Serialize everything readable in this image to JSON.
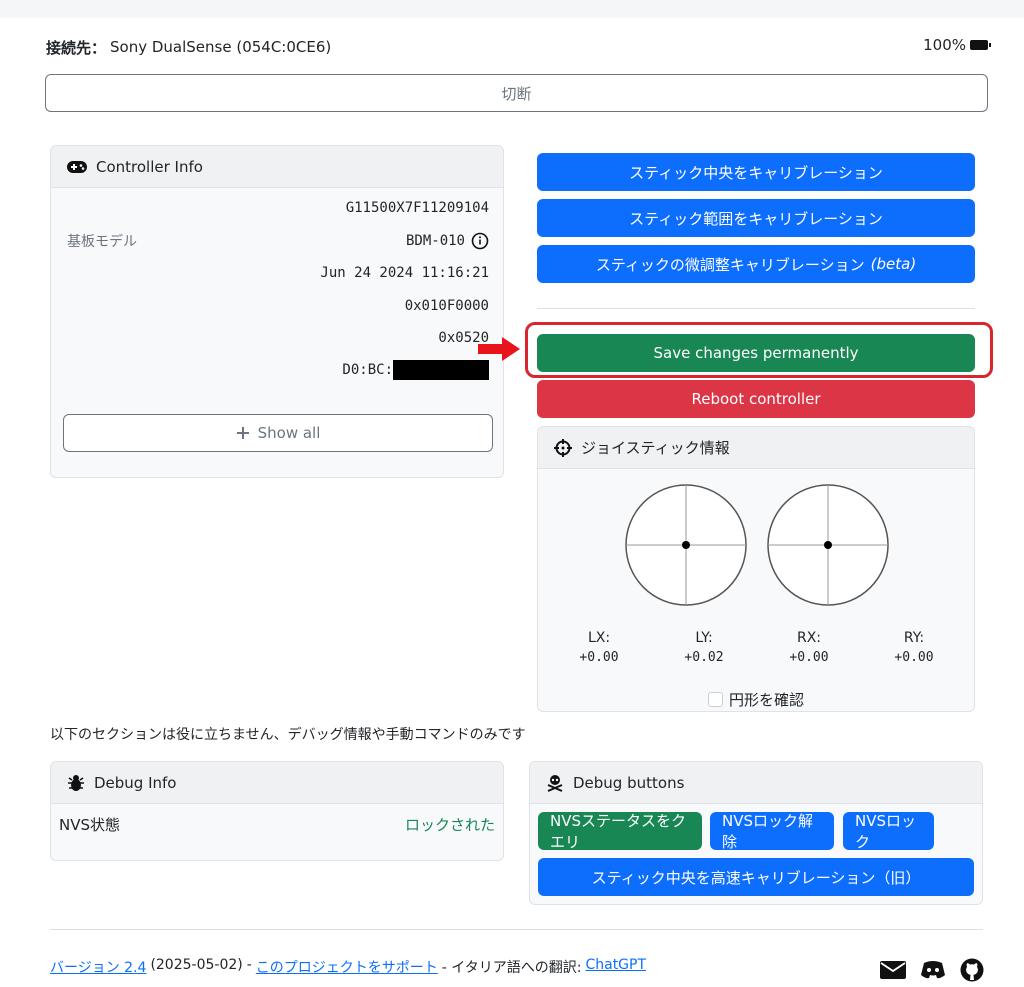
{
  "connection": {
    "label": "接続先：",
    "device": "Sony DualSense (054C:0CE6)",
    "battery": "100%"
  },
  "disconnect_label": "切断",
  "controller_info": {
    "title": "Controller Info",
    "rows": [
      {
        "label": "",
        "value": "G11500X7F11209104"
      },
      {
        "label": "基板モデル",
        "value": "BDM-010"
      },
      {
        "label": "",
        "value": "Jun 24 2024 11:16:21"
      },
      {
        "label": "",
        "value": "0x010F0000"
      },
      {
        "label": "",
        "value": "0x0520"
      },
      {
        "label": "",
        "value": "D0:BC:"
      }
    ],
    "show_all": "Show all"
  },
  "calibration": {
    "center": "スティック中央をキャリブレーション",
    "range": "スティック範囲をキャリブレーション",
    "fine": "スティックの微調整キャリブレーション",
    "fine_beta": "(beta)"
  },
  "save_label": "Save changes permanently",
  "reboot_label": "Reboot controller",
  "joystick": {
    "title": "ジョイスティック情報",
    "axes": [
      {
        "name": "LX:",
        "value": "+0.00"
      },
      {
        "name": "LY:",
        "value": "+0.02"
      },
      {
        "name": "RX:",
        "value": "+0.00"
      },
      {
        "name": "RY:",
        "value": "+0.00"
      }
    ],
    "circle_check_label": "円形を確認"
  },
  "debug_note": "以下のセクションは役に立ちません、デバッグ情報や手動コマンドのみです",
  "debug_info": {
    "title": "Debug Info",
    "nvs_label": "NVS状態",
    "nvs_value": "ロックされた"
  },
  "debug_buttons": {
    "title": "Debug buttons",
    "query": "NVSステータスをクエリ",
    "unlock": "NVSロック解除",
    "lock": "NVSロック",
    "fast_center": "スティック中央を高速キャリブレーション（旧）"
  },
  "footer": {
    "version_link": "バージョン 2.4",
    "date": "(2025-05-02)",
    "sep1": "-",
    "support_link": "このプロジェクトをサポート",
    "translation": "- イタリア語への翻訳:",
    "translator_link": "ChatGPT"
  },
  "colors": {
    "primary": "#0d6efd",
    "success": "#198754",
    "danger": "#dc3545",
    "highlight": "#d9262d"
  },
  "icons": [
    "battery-full-icon",
    "gamepad-icon",
    "info-circle-icon",
    "plus-icon",
    "crosshair-icon",
    "bug-icon",
    "skull-crossbones-icon",
    "mail-icon",
    "discord-icon",
    "github-icon"
  ]
}
